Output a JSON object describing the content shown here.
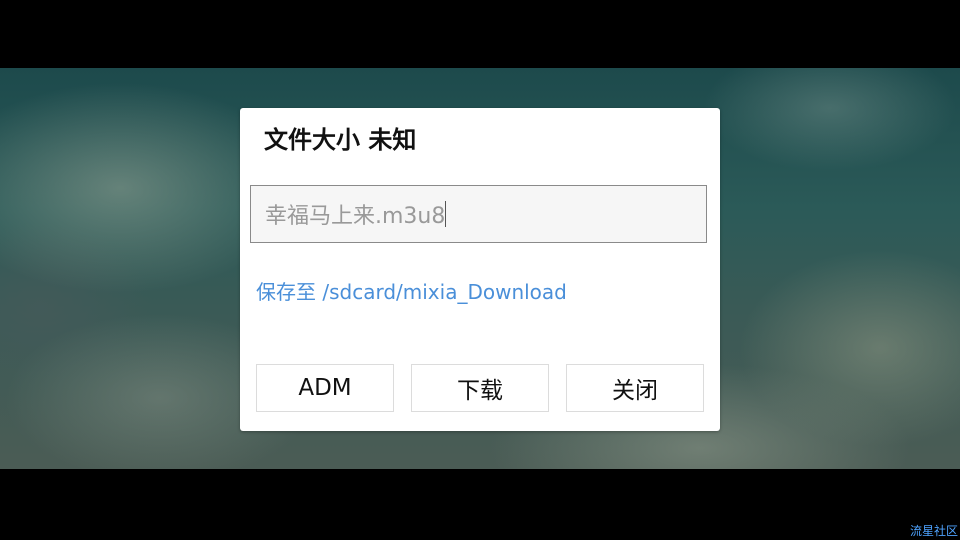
{
  "dialog": {
    "title": "文件大小 未知",
    "filename_value": "幸福马上来.m3u8",
    "save_path": "保存至 /sdcard/mixia_Download",
    "buttons": {
      "adm_label": "ADM",
      "download_label": "下载",
      "close_label": "关闭"
    }
  },
  "watermark": "流星社区",
  "colors": {
    "link_blue": "#4a8fd9",
    "dialog_bg": "#ffffff",
    "letterbox": "#000000"
  }
}
